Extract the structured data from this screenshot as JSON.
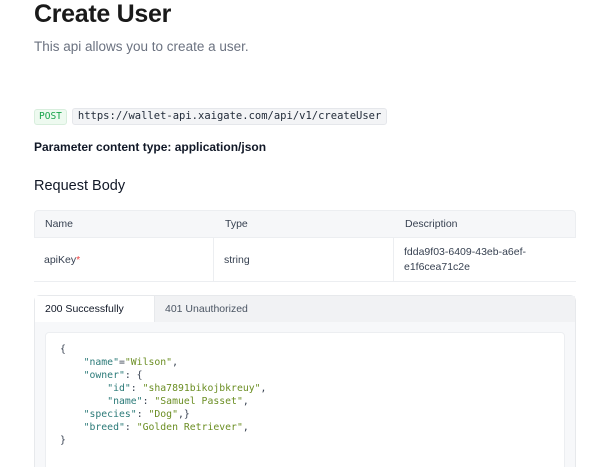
{
  "page": {
    "title": "Create User",
    "subtitle": "This api allows you to create a user."
  },
  "endpoint": {
    "method": "POST",
    "url": "https://wallet-api.xaigate.com/api/v1/createUser"
  },
  "content_type": "Parameter content type: application/json",
  "request_body": {
    "title": "Request Body",
    "columns": [
      "Name",
      "Type",
      "Description"
    ],
    "rows": [
      {
        "name": "apiKey",
        "required_mark": "*",
        "type": "string",
        "description": "fdda9f03-6409-43eb-a6ef-e1f6cea71c2e"
      }
    ]
  },
  "responses": {
    "tabs": [
      "200 Successfully",
      "401 Unauthorized"
    ],
    "active_tab": "200 Successfully",
    "code": {
      "l1": "{",
      "name_key": "\"name\"",
      "name_val": "\"Wilson\"",
      "owner_key": "\"owner\"",
      "id_key": "\"id\"",
      "id_val": "\"sha7891bikojbkreuy\"",
      "owner_name_key": "\"name\"",
      "owner_name_val": "\"Samuel Passet\"",
      "species_key": "\"species\"",
      "species_val": "\"Dog\"",
      "breed_key": "\"breed\"",
      "breed_val": "\"Golden Retriever\"",
      "l_end": "}"
    }
  }
}
